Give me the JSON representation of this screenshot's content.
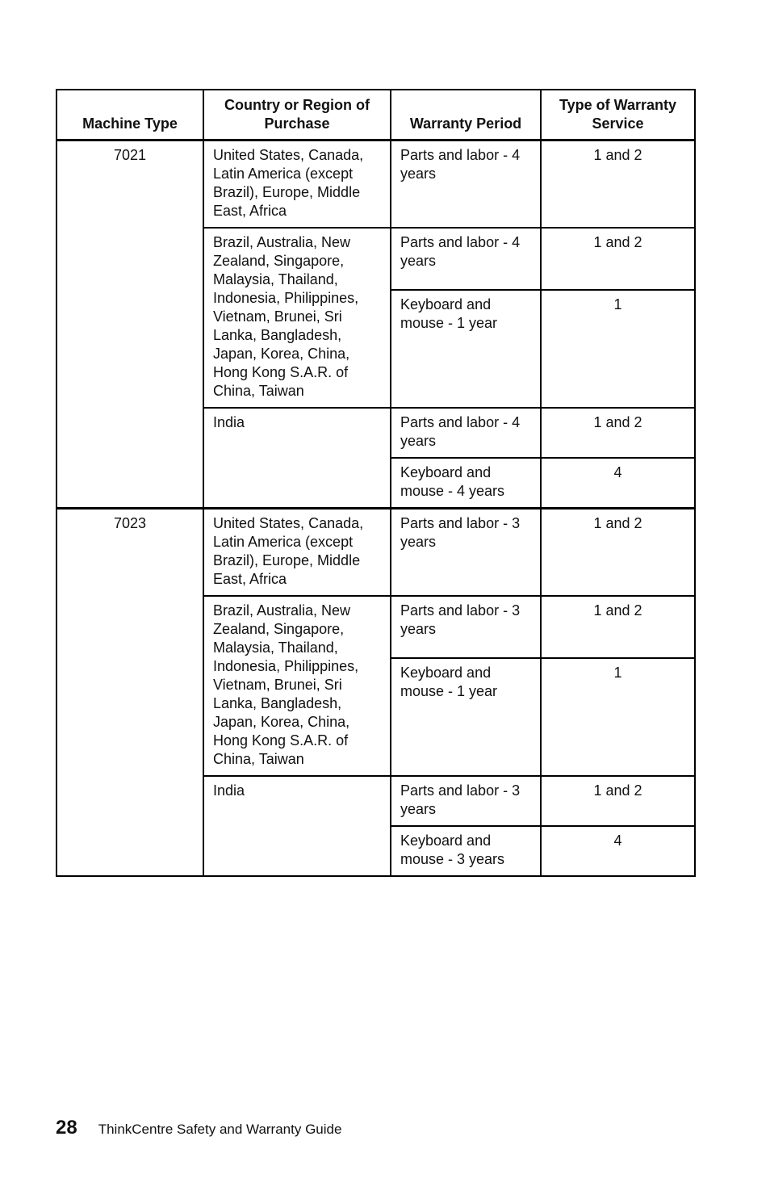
{
  "table": {
    "headers": [
      "Machine Type",
      "Country or Region of Purchase",
      "Warranty Period",
      "Type of Warranty Service"
    ],
    "machines": [
      {
        "type": "7021",
        "regions": [
          {
            "region": "United States, Canada, Latin America (except Brazil), Europe, Middle East, Africa",
            "entries": [
              {
                "period": "Parts and labor - 4 years",
                "service": "1 and 2"
              }
            ]
          },
          {
            "region": "Brazil, Australia, New Zealand, Singapore, Malaysia, Thailand, Indonesia, Philippines, Vietnam, Brunei, Sri Lanka, Bangladesh, Japan, Korea, China, Hong Kong S.A.R. of China, Taiwan",
            "entries": [
              {
                "period": "Parts and labor - 4 years",
                "service": "1 and 2"
              },
              {
                "period": "Keyboard and mouse - 1 year",
                "service": "1"
              }
            ]
          },
          {
            "region": "India",
            "entries": [
              {
                "period": "Parts and labor - 4 years",
                "service": "1 and 2"
              },
              {
                "period": "Keyboard and mouse - 4 years",
                "service": "4"
              }
            ]
          }
        ]
      },
      {
        "type": "7023",
        "regions": [
          {
            "region": "United States, Canada, Latin America (except Brazil), Europe, Middle East, Africa",
            "entries": [
              {
                "period": "Parts and labor - 3 years",
                "service": "1 and 2"
              }
            ]
          },
          {
            "region": "Brazil, Australia, New Zealand, Singapore, Malaysia, Thailand, Indonesia, Philippines, Vietnam, Brunei, Sri Lanka, Bangladesh, Japan, Korea, China, Hong Kong S.A.R. of China, Taiwan",
            "entries": [
              {
                "period": "Parts and labor - 3 years",
                "service": "1 and 2"
              },
              {
                "period": "Keyboard and mouse - 1 year",
                "service": "1"
              }
            ]
          },
          {
            "region": "India",
            "entries": [
              {
                "period": "Parts and labor - 3 years",
                "service": "1 and 2"
              },
              {
                "period": "Keyboard and mouse - 3 years",
                "service": "4"
              }
            ]
          }
        ]
      }
    ]
  },
  "footer": {
    "page_number": "28",
    "title": "ThinkCentre Safety and Warranty Guide"
  }
}
